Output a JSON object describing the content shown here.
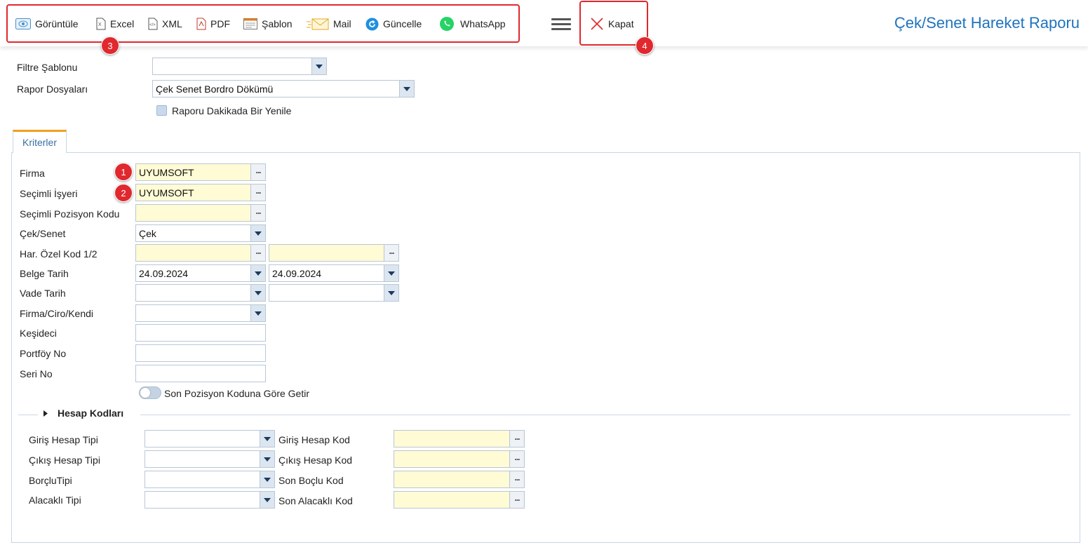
{
  "toolbar": {
    "view_label": "Görüntüle",
    "excel_label": "Excel",
    "xml_label": "XML",
    "pdf_label": "PDF",
    "template_label": "Şablon",
    "mail_label": "Mail",
    "refresh_label": "Güncelle",
    "whatsapp_label": "WhatsApp",
    "close_label": "Kapat",
    "page_title": "Çek/Senet Hareket Raporu"
  },
  "badges": {
    "b1": "1",
    "b2": "2",
    "b3": "3",
    "b4": "4"
  },
  "top_form": {
    "filter_template_label": "Filtre Şablonu",
    "filter_template_value": "",
    "report_files_label": "Rapor Dosyaları",
    "report_files_value": "Çek Senet Bordro Dökümü",
    "auto_refresh_label": "Raporu Dakikada Bir Yenile"
  },
  "tab": {
    "label": "Kriterler"
  },
  "criteria": {
    "firma_label": "Firma",
    "firma_value": "UYUMSOFT",
    "isyeri_label": "Seçimli İşyeri",
    "isyeri_value": "UYUMSOFT",
    "pozisyon_label": "Seçimli Pozisyon Kodu",
    "pozisyon_value": "",
    "ceksenet_label": "Çek/Senet",
    "ceksenet_value": "Çek",
    "ozelkod_label": "Har. Özel Kod 1/2",
    "ozelkod1_value": "",
    "ozelkod2_value": "",
    "belge_tarih_label": "Belge Tarih",
    "belge_tarih_from": "24.09.2024",
    "belge_tarih_to": "24.09.2024",
    "vade_tarih_label": "Vade Tarih",
    "vade_from": "",
    "vade_to": "",
    "ciro_label": "Firma/Ciro/Kendi",
    "ciro_value": "",
    "kesideci_label": "Keşideci",
    "kesideci_value": "",
    "portfoy_label": "Portföy No",
    "portfoy_value": "",
    "seri_label": "Seri No",
    "seri_value": "",
    "son_pozisyon_label": "Son Pozisyon Koduna Göre Getir"
  },
  "hesap": {
    "section_label": "Hesap Kodları",
    "giris_tipi_label": "Giriş Hesap Tipi",
    "cikis_tipi_label": "Çıkış Hesap Tipi",
    "borclu_tipi_label": "BorçluTipi",
    "alacakli_tipi_label": "Alacaklı Tipi",
    "giris_kod_label": "Giriş Hesap Kod",
    "cikis_kod_label": "Çıkış Hesap Kod",
    "son_borclu_label": "Son Boçlu Kod",
    "son_alacakli_label": "Son Alacaklı Kod"
  },
  "colors": {
    "accent": "#1e73be",
    "highlight": "#e0282e",
    "tab_accent": "#f0a020",
    "required_field": "#fffbd5"
  }
}
